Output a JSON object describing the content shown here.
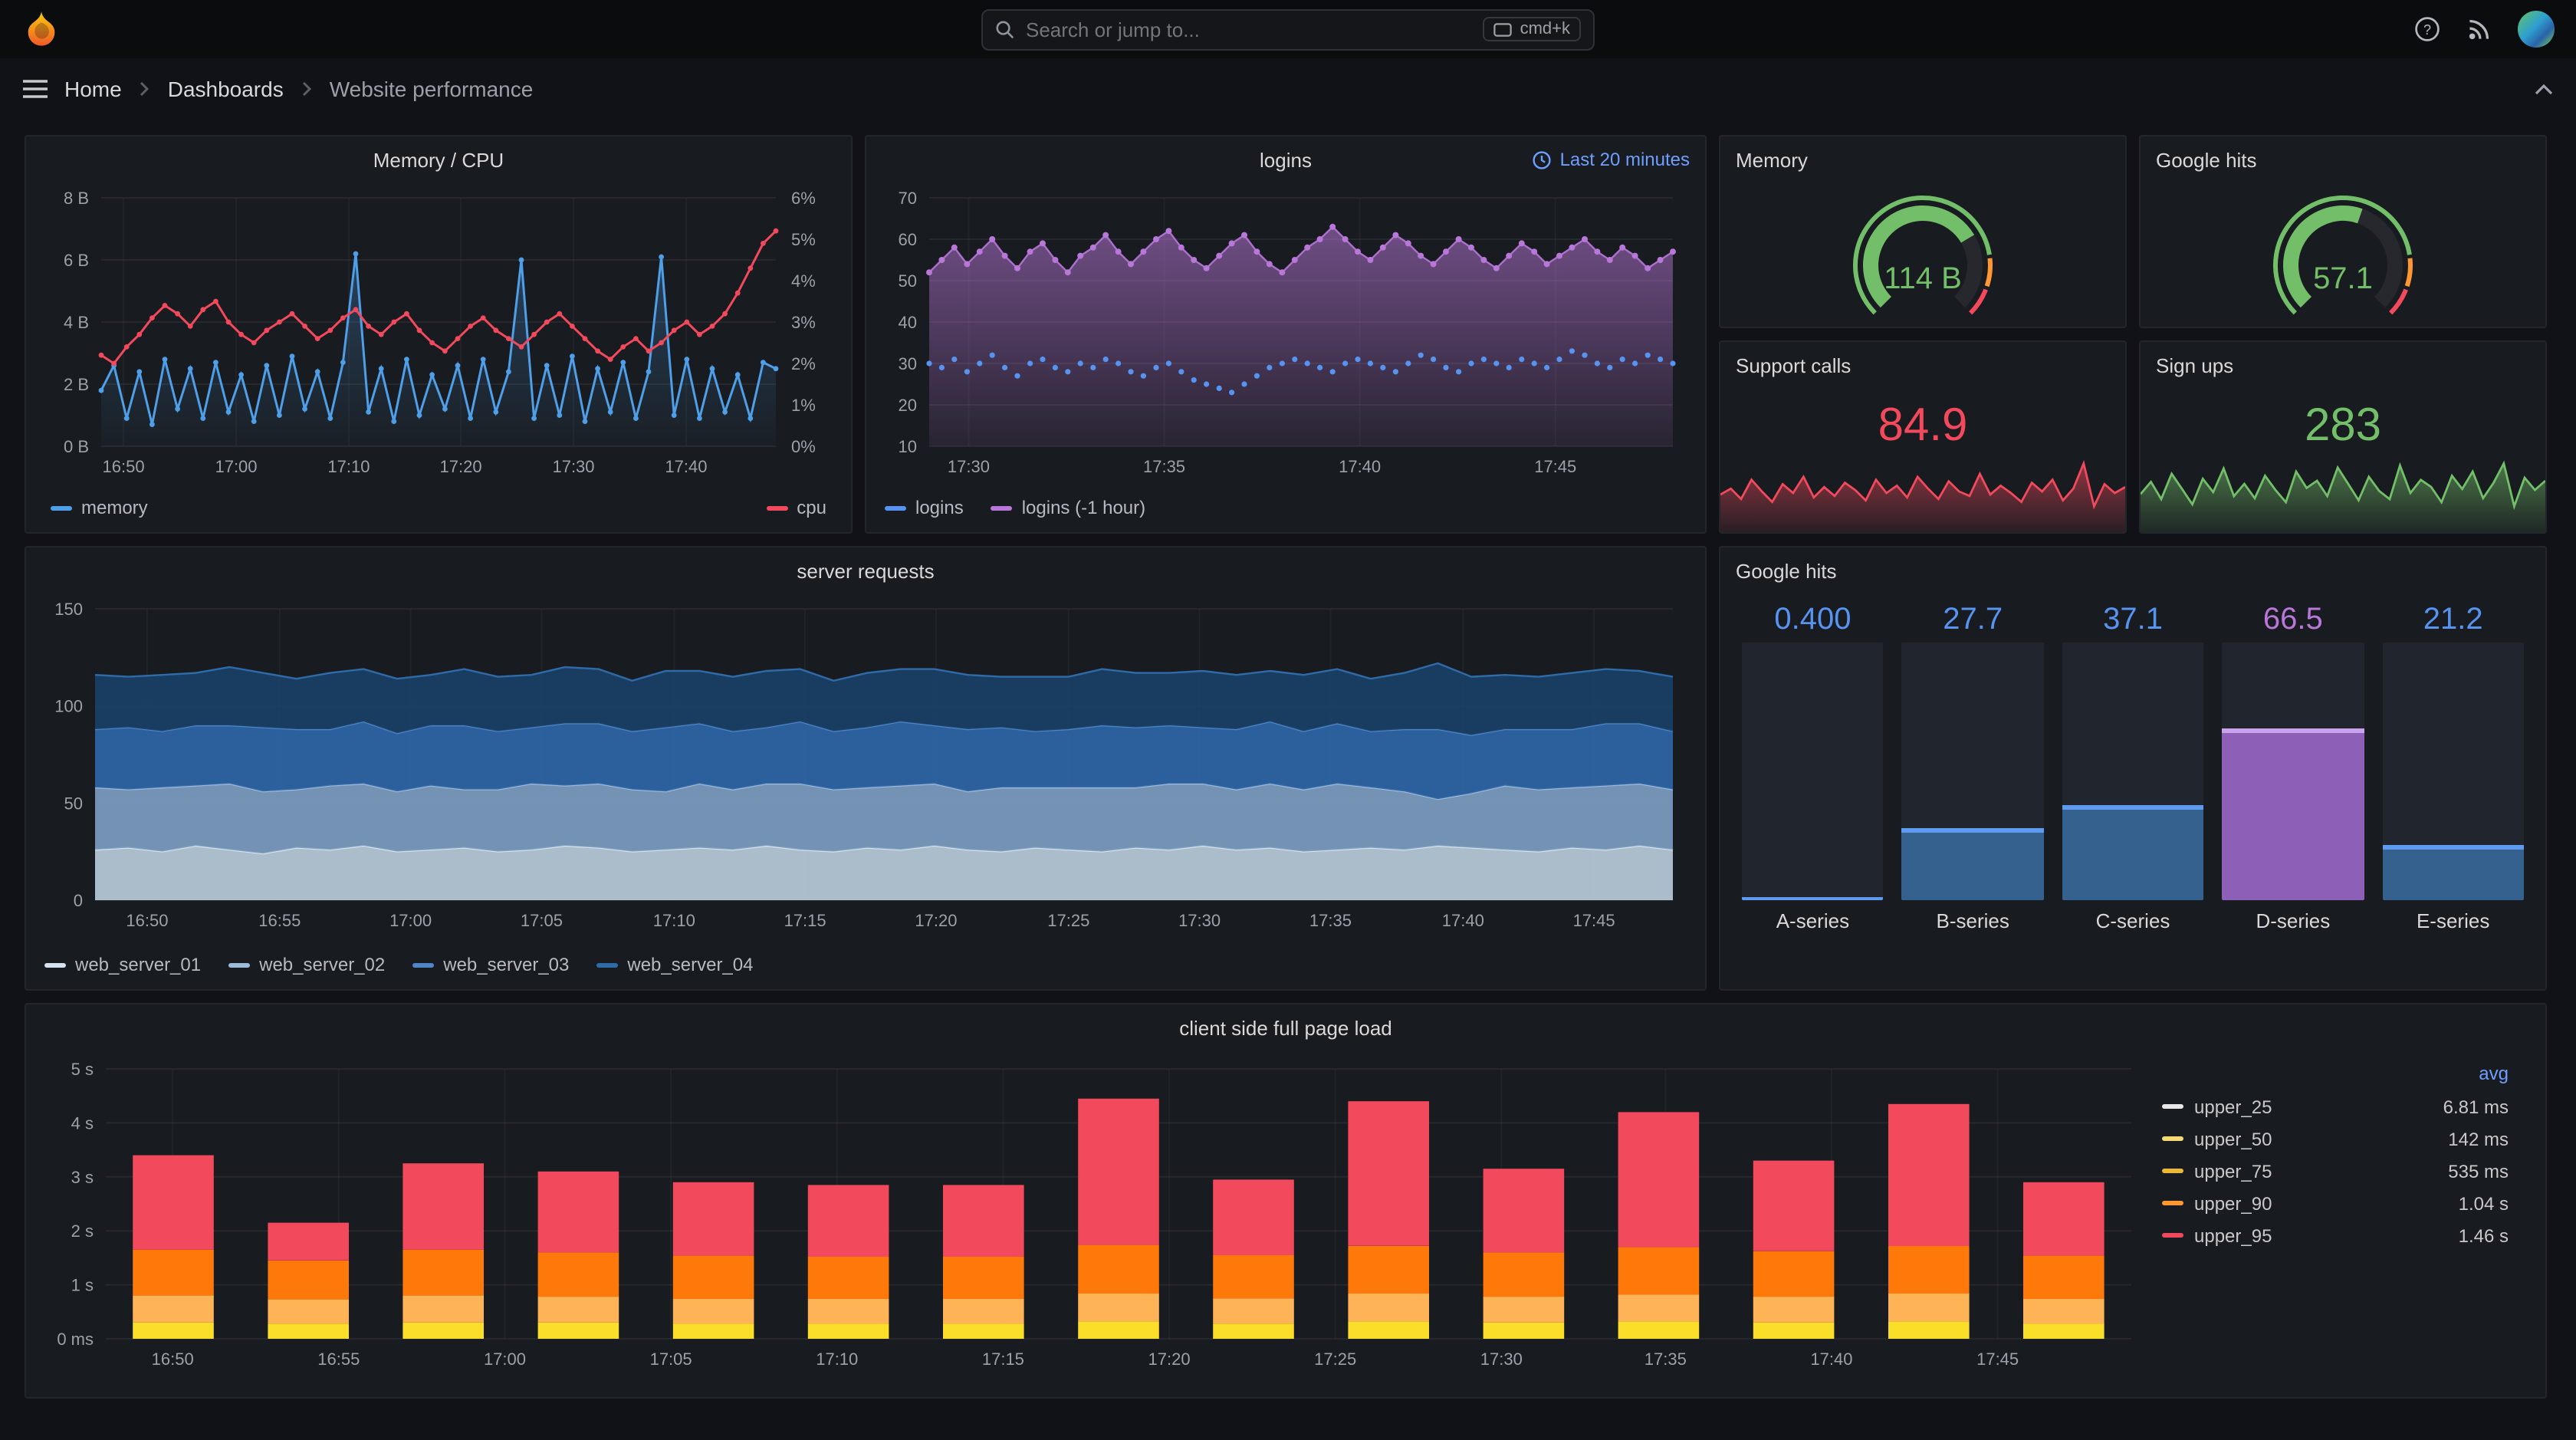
{
  "navbar": {
    "search_placeholder": "Search or jump to...",
    "shortcut_label": "cmd+k"
  },
  "breadcrumb": {
    "items": [
      {
        "label": "Home"
      },
      {
        "label": "Dashboards"
      },
      {
        "label": "Website performance"
      }
    ]
  },
  "colors": {
    "background": "#111217",
    "panel": "#181b1f",
    "border": "#23262b",
    "blue": "#5794F2",
    "red": "#F2495C",
    "green": "#73BF69",
    "orange": "#FF9830",
    "yellow": "#FADE2A",
    "purple": "#B877D9",
    "link_blue": "#6E9FFF"
  },
  "panels": {
    "memory_cpu": {
      "title": "Memory / CPU"
    },
    "logins": {
      "title": "logins",
      "time_link": "Last 20 minutes"
    },
    "memory_gauge": {
      "title": "Memory",
      "value": "114 B"
    },
    "google_gauge": {
      "title": "Google hits",
      "value": "57.1"
    },
    "support_calls": {
      "title": "Support calls",
      "value": "84.9"
    },
    "sign_ups": {
      "title": "Sign ups",
      "value": "283"
    },
    "server_requests": {
      "title": "server requests"
    },
    "google_bars": {
      "title": "Google hits"
    },
    "page_load": {
      "title": "client side full page load"
    }
  },
  "chart_data": [
    {
      "id": "memory_cpu",
      "type": "line",
      "title": "Memory / CPU",
      "x_range": [
        "16:50",
        "17:48"
      ],
      "x_ticks": [
        {
          "f": 0.033,
          "label": "16:50"
        },
        {
          "f": 0.2,
          "label": "17:00"
        },
        {
          "f": 0.367,
          "label": "17:10"
        },
        {
          "f": 0.533,
          "label": "17:20"
        },
        {
          "f": 0.7,
          "label": "17:30"
        },
        {
          "f": 0.867,
          "label": "17:40"
        }
      ],
      "y_left": {
        "min": 0,
        "max": 8,
        "ticks": [
          "0 B",
          "2 B",
          "4 B",
          "6 B",
          "8 B"
        ]
      },
      "y_right": {
        "min": 0,
        "max": 6,
        "ticks": [
          "0%",
          "1%",
          "2%",
          "3%",
          "4%",
          "5%",
          "6%"
        ]
      },
      "series": [
        {
          "name": "memory",
          "axis": "left",
          "color": "#4F9EE8",
          "values": [
            1.8,
            2.6,
            0.9,
            2.4,
            0.7,
            2.8,
            1.2,
            2.5,
            0.9,
            2.7,
            1.1,
            2.3,
            0.8,
            2.6,
            1.0,
            2.9,
            1.2,
            2.4,
            0.9,
            2.7,
            6.2,
            1.1,
            2.5,
            0.8,
            2.8,
            1.0,
            2.3,
            1.2,
            2.6,
            0.9,
            2.8,
            1.1,
            2.4,
            6.0,
            0.9,
            2.6,
            1.0,
            2.9,
            0.8,
            2.5,
            1.1,
            2.7,
            0.9,
            2.4,
            6.1,
            1.0,
            2.8,
            0.9,
            2.5,
            1.1,
            2.3,
            0.9,
            2.7,
            2.5
          ]
        },
        {
          "name": "cpu",
          "axis": "right",
          "color": "#F2495C",
          "values": [
            2.2,
            2.0,
            2.4,
            2.7,
            3.1,
            3.4,
            3.2,
            2.9,
            3.3,
            3.5,
            3.0,
            2.7,
            2.5,
            2.8,
            3.0,
            3.2,
            2.9,
            2.6,
            2.8,
            3.1,
            3.3,
            2.9,
            2.7,
            3.0,
            3.2,
            2.8,
            2.5,
            2.3,
            2.6,
            2.9,
            3.1,
            2.8,
            2.6,
            2.4,
            2.7,
            3.0,
            3.2,
            2.9,
            2.6,
            2.3,
            2.1,
            2.4,
            2.6,
            2.3,
            2.5,
            2.8,
            3.0,
            2.7,
            2.9,
            3.2,
            3.7,
            4.3,
            4.9,
            5.2
          ]
        }
      ]
    },
    {
      "id": "logins",
      "type": "line",
      "title": "logins",
      "time_range_label": "Last 20 minutes",
      "x_range": [
        "17:29",
        "17:48"
      ],
      "x_ticks": [
        {
          "f": 0.053,
          "label": "17:30"
        },
        {
          "f": 0.316,
          "label": "17:35"
        },
        {
          "f": 0.579,
          "label": "17:40"
        },
        {
          "f": 0.842,
          "label": "17:45"
        }
      ],
      "y": {
        "min": 10,
        "max": 70,
        "ticks": [
          "10",
          "20",
          "30",
          "40",
          "50",
          "60",
          "70"
        ]
      },
      "series": [
        {
          "name": "logins",
          "color": "#5794F2",
          "style": "points",
          "values": [
            30,
            29,
            31,
            28,
            30,
            32,
            29,
            27,
            30,
            31,
            29,
            28,
            30,
            29,
            31,
            30,
            28,
            27,
            29,
            30,
            28,
            26,
            25,
            24,
            23,
            25,
            27,
            29,
            30,
            31,
            30,
            29,
            28,
            30,
            31,
            30,
            29,
            28,
            30,
            32,
            31,
            29,
            28,
            30,
            31,
            30,
            29,
            31,
            30,
            29,
            31,
            33,
            32,
            30,
            29,
            31,
            30,
            32,
            31,
            30
          ]
        },
        {
          "name": "logins (-1 hour)",
          "color": "#B877D9",
          "style": "area-points",
          "values": [
            52,
            55,
            58,
            54,
            57,
            60,
            56,
            53,
            57,
            59,
            55,
            52,
            56,
            58,
            61,
            57,
            54,
            57,
            60,
            62,
            58,
            55,
            53,
            56,
            59,
            61,
            57,
            54,
            52,
            55,
            58,
            60,
            63,
            60,
            57,
            55,
            58,
            61,
            59,
            56,
            54,
            57,
            60,
            58,
            55,
            53,
            56,
            59,
            57,
            54,
            56,
            58,
            60,
            57,
            55,
            58,
            56,
            53,
            55,
            57
          ]
        }
      ]
    },
    {
      "id": "memory_gauge",
      "type": "gauge",
      "title": "Memory",
      "value": 114,
      "display": "114 B",
      "fraction": 0.72,
      "color": "#73BF69",
      "thresholds": [
        {
          "to": 0.8,
          "color": "#73BF69"
        },
        {
          "to": 0.9,
          "color": "#FF9830"
        },
        {
          "to": 1.0,
          "color": "#F2495C"
        }
      ]
    },
    {
      "id": "google_gauge",
      "type": "gauge",
      "title": "Google hits",
      "value": 57.1,
      "display": "57.1",
      "fraction": 0.571,
      "color": "#73BF69",
      "thresholds": [
        {
          "to": 0.8,
          "color": "#73BF69"
        },
        {
          "to": 0.9,
          "color": "#FF9830"
        },
        {
          "to": 1.0,
          "color": "#F2495C"
        }
      ]
    },
    {
      "id": "support_calls_spark",
      "type": "area",
      "title": "Support calls",
      "value": 84.9,
      "color": "#F2495C",
      "values": [
        78,
        82,
        75,
        88,
        80,
        73,
        85,
        79,
        90,
        76,
        83,
        77,
        86,
        81,
        74,
        88,
        79,
        84,
        76,
        90,
        82,
        75,
        87,
        80,
        77,
        92,
        78,
        84,
        79,
        73,
        86,
        80,
        88,
        74,
        82,
        99,
        70,
        85,
        79,
        83
      ]
    },
    {
      "id": "sign_ups_spark",
      "type": "area",
      "title": "Sign ups",
      "value": 283,
      "color": "#73BF69",
      "values": [
        270,
        282,
        265,
        290,
        275,
        260,
        285,
        272,
        295,
        268,
        280,
        266,
        288,
        274,
        262,
        292,
        276,
        283,
        268,
        296,
        280,
        264,
        287,
        273,
        265,
        298,
        271,
        284,
        277,
        262,
        288,
        275,
        292,
        266,
        281,
        300,
        258,
        286,
        274,
        283
      ]
    },
    {
      "id": "server_requests",
      "type": "area",
      "title": "server requests",
      "x_range": [
        "16:48",
        "17:48"
      ],
      "x_ticks": [
        {
          "f": 0.033,
          "label": "16:50"
        },
        {
          "f": 0.117,
          "label": "16:55"
        },
        {
          "f": 0.2,
          "label": "17:00"
        },
        {
          "f": 0.283,
          "label": "17:05"
        },
        {
          "f": 0.367,
          "label": "17:10"
        },
        {
          "f": 0.45,
          "label": "17:15"
        },
        {
          "f": 0.533,
          "label": "17:20"
        },
        {
          "f": 0.617,
          "label": "17:25"
        },
        {
          "f": 0.7,
          "label": "17:30"
        },
        {
          "f": 0.783,
          "label": "17:35"
        },
        {
          "f": 0.867,
          "label": "17:40"
        },
        {
          "f": 0.95,
          "label": "17:45"
        }
      ],
      "y": {
        "min": 0,
        "max": 150,
        "ticks": [
          "0",
          "50",
          "100",
          "150"
        ]
      },
      "stacked": true,
      "series": [
        {
          "name": "web_server_01",
          "color": "#D5E3EE",
          "fill": "#B9CBD9",
          "values": [
            26,
            27,
            25,
            28,
            26,
            24,
            27,
            26,
            28,
            25,
            26,
            27,
            25,
            26,
            28,
            27,
            25,
            26,
            27,
            26,
            28,
            26,
            25,
            27,
            26,
            28,
            26,
            25,
            27,
            26,
            25,
            27,
            26,
            28,
            26,
            27,
            25,
            26,
            27,
            26,
            28,
            27,
            26,
            25,
            27,
            26,
            28,
            26
          ]
        },
        {
          "name": "web_server_02",
          "color": "#9FBBDA",
          "fill": "#7C9CC1",
          "values": [
            32,
            30,
            33,
            31,
            34,
            32,
            30,
            33,
            32,
            31,
            33,
            30,
            32,
            34,
            31,
            33,
            32,
            30,
            33,
            31,
            32,
            34,
            32,
            31,
            33,
            32,
            30,
            33,
            31,
            32,
            33,
            31,
            34,
            32,
            31,
            33,
            32,
            34,
            31,
            30,
            24,
            28,
            33,
            32,
            31,
            33,
            32,
            31
          ]
        },
        {
          "name": "web_server_03",
          "color": "#4E86C8",
          "fill": "#2F66A8",
          "values": [
            30,
            32,
            29,
            31,
            30,
            33,
            31,
            29,
            32,
            30,
            31,
            33,
            30,
            29,
            32,
            31,
            30,
            33,
            31,
            30,
            29,
            32,
            30,
            31,
            33,
            30,
            32,
            31,
            29,
            30,
            32,
            31,
            30,
            29,
            31,
            32,
            30,
            31,
            29,
            32,
            36,
            30,
            29,
            31,
            30,
            32,
            31,
            30
          ]
        },
        {
          "name": "web_server_04",
          "color": "#2F6BA8",
          "fill": "#1A4066",
          "values": [
            28,
            26,
            29,
            27,
            30,
            28,
            26,
            29,
            27,
            28,
            26,
            29,
            28,
            27,
            29,
            28,
            26,
            29,
            27,
            28,
            29,
            27,
            26,
            28,
            27,
            29,
            28,
            26,
            28,
            27,
            29,
            28,
            27,
            29,
            28,
            26,
            29,
            28,
            27,
            29,
            34,
            30,
            28,
            27,
            29,
            28,
            27,
            28
          ]
        }
      ]
    },
    {
      "id": "google_bars",
      "type": "bar",
      "title": "Google hits",
      "max": 100,
      "bars": [
        {
          "label": "A-series",
          "value": 0.4,
          "display": "0.400",
          "color": "#5794F2",
          "fill": "#35618F",
          "cap": "#5E9BF0"
        },
        {
          "label": "B-series",
          "value": 27.7,
          "display": "27.7",
          "color": "#5794F2",
          "fill": "#35618F",
          "cap": "#5E9BF0"
        },
        {
          "label": "C-series",
          "value": 37.1,
          "display": "37.1",
          "color": "#5794F2",
          "fill": "#35618F",
          "cap": "#5E9BF0"
        },
        {
          "label": "D-series",
          "value": 66.5,
          "display": "66.5",
          "color": "#B877D9",
          "fill": "#8E5FB7",
          "cap": "#C9A1EC"
        },
        {
          "label": "E-series",
          "value": 21.2,
          "display": "21.2",
          "color": "#5794F2",
          "fill": "#35618F",
          "cap": "#5E9BF0"
        }
      ]
    },
    {
      "id": "page_load",
      "type": "bar",
      "title": "client side full page load",
      "stacked": true,
      "x_range": [
        "16:48",
        "17:49"
      ],
      "x_ticks": [
        {
          "f": 0.033,
          "label": "16:50"
        },
        {
          "f": 0.115,
          "label": "16:55"
        },
        {
          "f": 0.197,
          "label": "17:00"
        },
        {
          "f": 0.279,
          "label": "17:05"
        },
        {
          "f": 0.361,
          "label": "17:10"
        },
        {
          "f": 0.443,
          "label": "17:15"
        },
        {
          "f": 0.525,
          "label": "17:20"
        },
        {
          "f": 0.607,
          "label": "17:25"
        },
        {
          "f": 0.689,
          "label": "17:30"
        },
        {
          "f": 0.77,
          "label": "17:35"
        },
        {
          "f": 0.852,
          "label": "17:40"
        },
        {
          "f": 0.934,
          "label": "17:45"
        }
      ],
      "y": {
        "min": 0,
        "max": 5,
        "ticks": [
          "0 ms",
          "1 s",
          "2 s",
          "3 s",
          "4 s",
          "5 s"
        ]
      },
      "segment_colors": [
        "#FADE2A",
        "#FFB357",
        "#FF780A",
        "#F2495C"
      ],
      "bars": [
        [
          0.3,
          0.5,
          0.85,
          1.75
        ],
        [
          0.28,
          0.45,
          0.72,
          0.7
        ],
        [
          0.3,
          0.5,
          0.85,
          1.6
        ],
        [
          0.3,
          0.48,
          0.82,
          1.5
        ],
        [
          0.28,
          0.46,
          0.8,
          1.36
        ],
        [
          0.28,
          0.46,
          0.78,
          1.33
        ],
        [
          0.28,
          0.46,
          0.78,
          1.33
        ],
        [
          0.32,
          0.52,
          0.9,
          2.71
        ],
        [
          0.28,
          0.47,
          0.8,
          1.4
        ],
        [
          0.32,
          0.52,
          0.88,
          2.68
        ],
        [
          0.3,
          0.48,
          0.82,
          1.55
        ],
        [
          0.32,
          0.5,
          0.88,
          2.5
        ],
        [
          0.3,
          0.48,
          0.84,
          1.68
        ],
        [
          0.32,
          0.52,
          0.88,
          2.63
        ],
        [
          0.28,
          0.46,
          0.8,
          1.36
        ]
      ],
      "legend": {
        "header": "avg",
        "rows": [
          {
            "name": "upper_25",
            "value": "6.81 ms",
            "color": "#E8E8E8"
          },
          {
            "name": "upper_50",
            "value": "142 ms",
            "color": "#F5D974"
          },
          {
            "name": "upper_75",
            "value": "535 ms",
            "color": "#EAB839"
          },
          {
            "name": "upper_90",
            "value": "1.04 s",
            "color": "#FF9830"
          },
          {
            "name": "upper_95",
            "value": "1.46 s",
            "color": "#F2495C"
          }
        ]
      }
    }
  ]
}
